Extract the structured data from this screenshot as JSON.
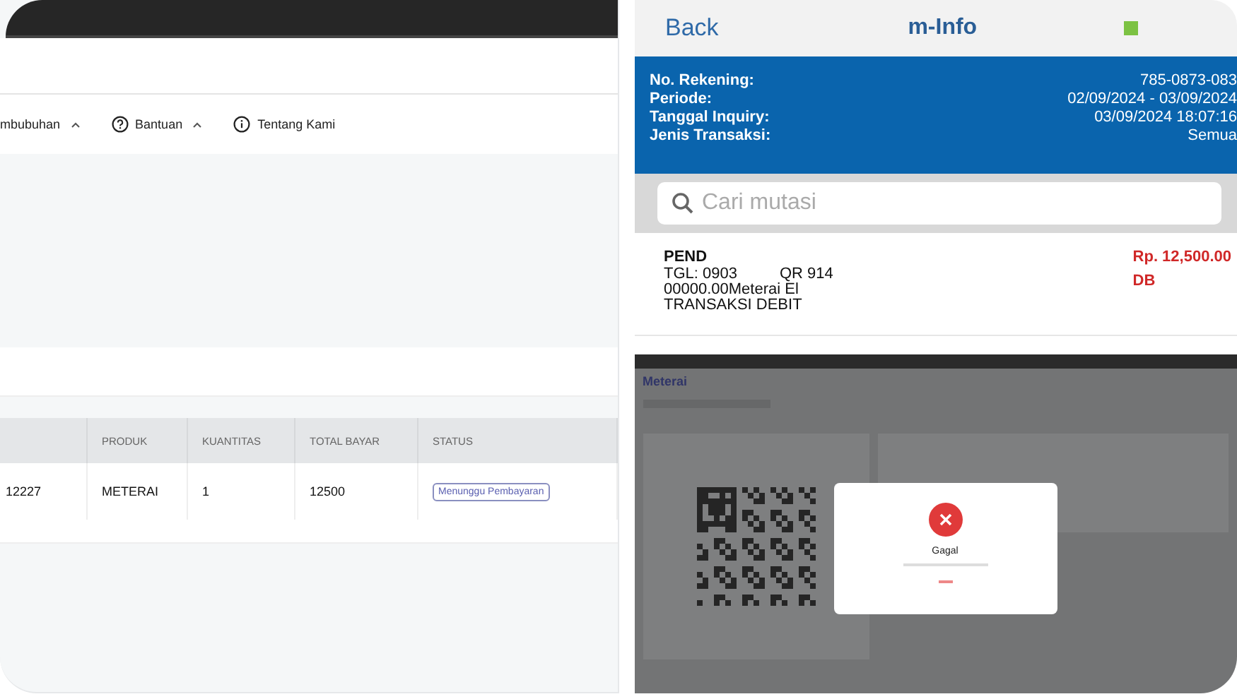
{
  "web_page": {
    "nav": [
      {
        "label": "mbubuhan",
        "kind": "plain",
        "caret": true
      },
      {
        "label": "Bantuan",
        "kind": "help",
        "caret": true
      },
      {
        "label": "Tentang Kami",
        "kind": "about",
        "caret": false
      }
    ],
    "table": {
      "columns": [
        {
          "kind": "blank"
        },
        {
          "kind": "text",
          "label": "PRODUK"
        },
        {
          "kind": "text",
          "label": "KUANTITAS"
        },
        {
          "kind": "text",
          "label": "TOTAL BAYAR"
        },
        {
          "kind": "text",
          "label": "STATUS"
        }
      ],
      "rows": [
        {
          "cells": [
            "12227",
            "METERAI",
            "1",
            "12500"
          ],
          "status": "Menunggu Pembayaran"
        }
      ]
    }
  },
  "mobile_app": {
    "back": "Back",
    "title": "m-Info",
    "account": [
      {
        "label": "No. Rekening:",
        "value": "785-0873-083"
      },
      {
        "label": "Periode:",
        "value": "02/09/2024 - 03/09/2024"
      },
      {
        "label": "Tanggal Inquiry:",
        "value": "03/09/2024 18:07:16"
      },
      {
        "label": "Jenis Transaksi:",
        "value": "Semua"
      }
    ],
    "search": {
      "placeholder": "Cari mutasi"
    },
    "transactions": [
      {
        "title": "PEND",
        "date": "TGL: 0903",
        "ref": "QR  914",
        "lines": [
          "00000.00Meterai El",
          "TRANSAKSI DEBIT"
        ],
        "amount": "Rp. 12,500.00",
        "type": "DB"
      }
    ]
  },
  "failed_screenshot": {
    "logo": "Meterai",
    "dialog_title": "Gagal"
  }
}
